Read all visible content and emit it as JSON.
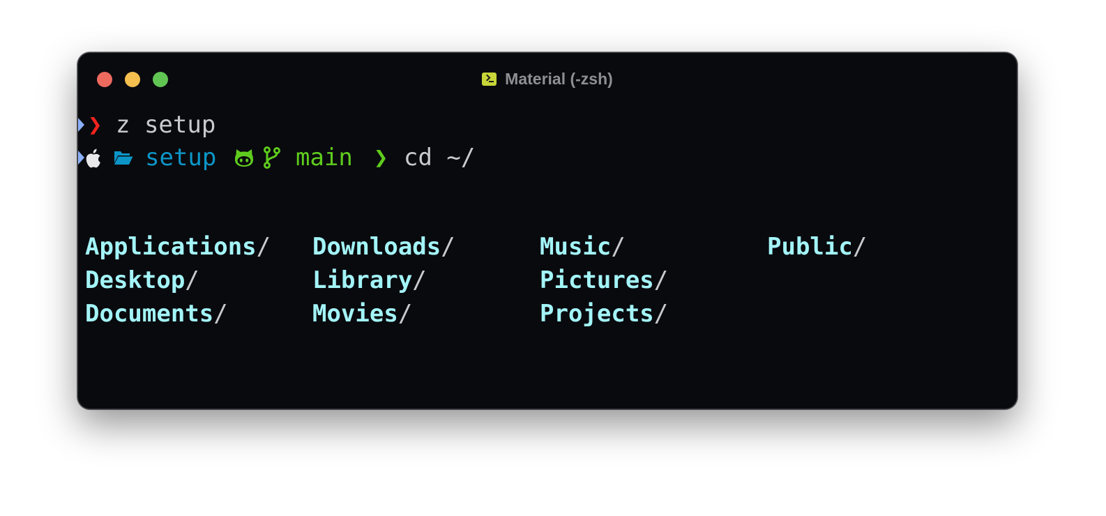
{
  "window": {
    "title": "Material (-zsh)",
    "title_icon": "terminal-icon"
  },
  "terminal": {
    "line1": {
      "prompt_symbol": "❯",
      "command": "z setup"
    },
    "line2": {
      "os_icon": "apple-icon",
      "dir_icon": "folder-open-icon",
      "directory": "setup",
      "vcs_icon": "github-icon",
      "branch_icon": "git-branch-icon",
      "branch": "main",
      "prompt_symbol": "❯",
      "command": "cd ~/"
    },
    "ls_output": [
      {
        "name": "Applications",
        "suffix": "/"
      },
      {
        "name": "Desktop",
        "suffix": "/"
      },
      {
        "name": "Documents",
        "suffix": "/"
      },
      {
        "name": "Downloads",
        "suffix": "/"
      },
      {
        "name": "Library",
        "suffix": "/"
      },
      {
        "name": "Movies",
        "suffix": "/"
      },
      {
        "name": "Music",
        "suffix": "/"
      },
      {
        "name": "Pictures",
        "suffix": "/"
      },
      {
        "name": "Projects",
        "suffix": "/"
      },
      {
        "name": "Public",
        "suffix": "/"
      }
    ]
  },
  "colors": {
    "background": "#090a0e",
    "prompt_error": "#f2241f",
    "directory": "#0c96c8",
    "branch": "#5fcc1d",
    "ls_directory": "#a3f4f7",
    "text": "#c9cacd"
  }
}
